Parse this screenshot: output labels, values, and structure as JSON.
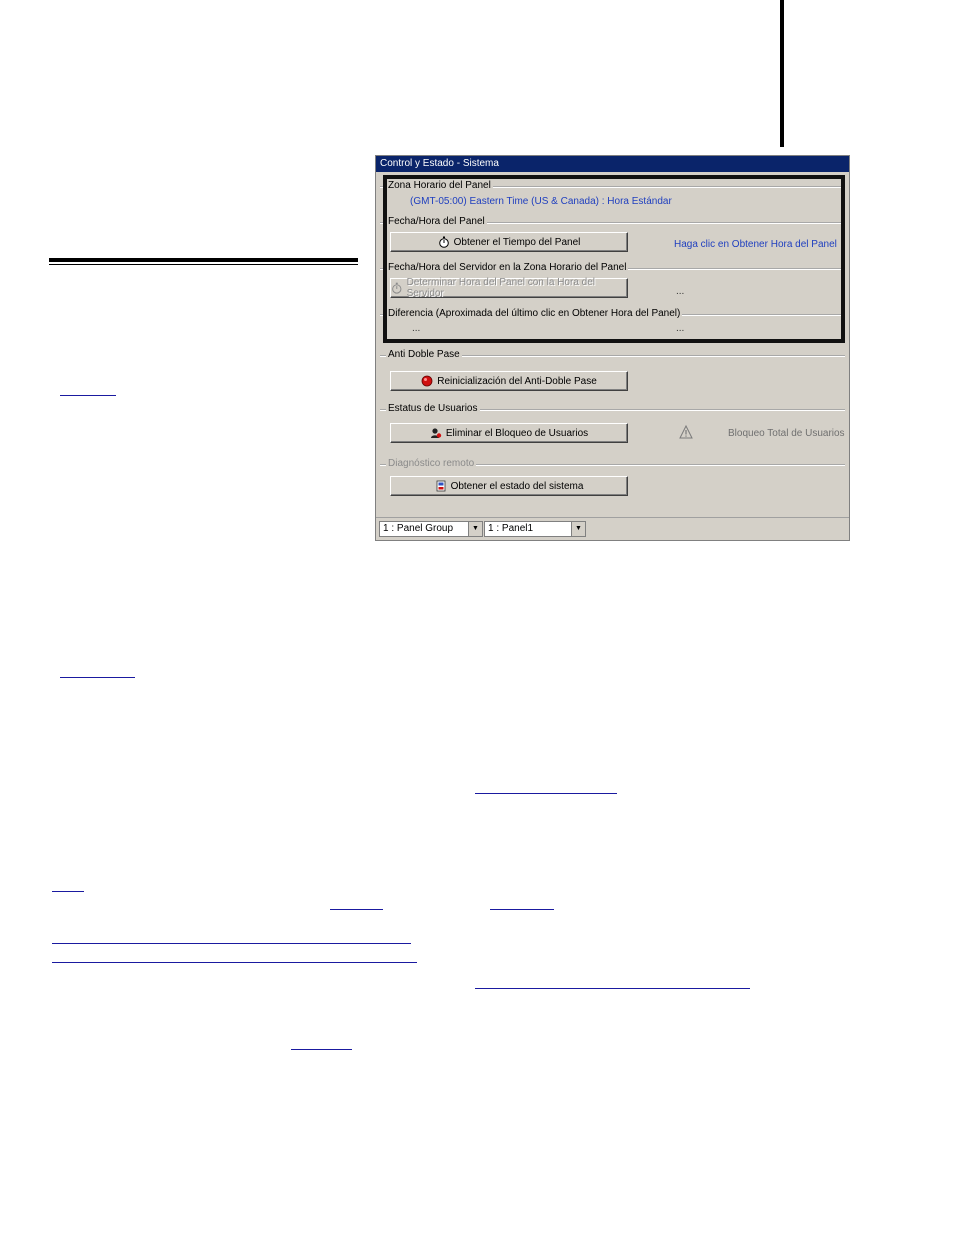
{
  "window": {
    "title": "Control y Estado - Sistema",
    "groups": {
      "zona_horaria": {
        "label": "Zona Horario del Panel",
        "value": "(GMT-05:00) Eastern Time (US & Canada) : Hora Estándar"
      },
      "fecha_hora_panel": {
        "label": "Fecha/Hora del Panel",
        "button": "Obtener el Tiempo del Panel",
        "hint": "Haga clic en Obtener Hora del Panel"
      },
      "fecha_hora_servidor": {
        "label": "Fecha/Hora del Servidor en la Zona Horario del Panel",
        "button": "Determinar Hora del Panel con la Hora del Servidor",
        "value": "..."
      },
      "diferencia": {
        "label": "Diferencia (Aproximada del último clic en Obtener Hora del Panel)",
        "value_left": "...",
        "value_right": "..."
      },
      "anti_doble_pase": {
        "label": "Anti Doble Pase",
        "button": "Reinicialización del Anti-Doble Pase"
      },
      "estatus_usuarios": {
        "label": "Estatus de Usuarios",
        "button": "Eliminar el Bloqueo de Usuarios",
        "status": "Bloqueo Total de Usuarios"
      },
      "diagnostico": {
        "label": "Diagnóstico remoto",
        "button": "Obtener el estado del sistema"
      }
    },
    "statusbar": {
      "panel_group": "1 : Panel Group",
      "panel": "1 : Panel1"
    }
  },
  "colors": {
    "titlebar": "#0a246a",
    "window_bg": "#d4d0c8",
    "info_text": "#1f3fbf"
  },
  "icons": [
    "stopwatch-icon",
    "red-circle-icon",
    "user-unlock-icon",
    "warning-icon",
    "diagnostic-icon"
  ]
}
